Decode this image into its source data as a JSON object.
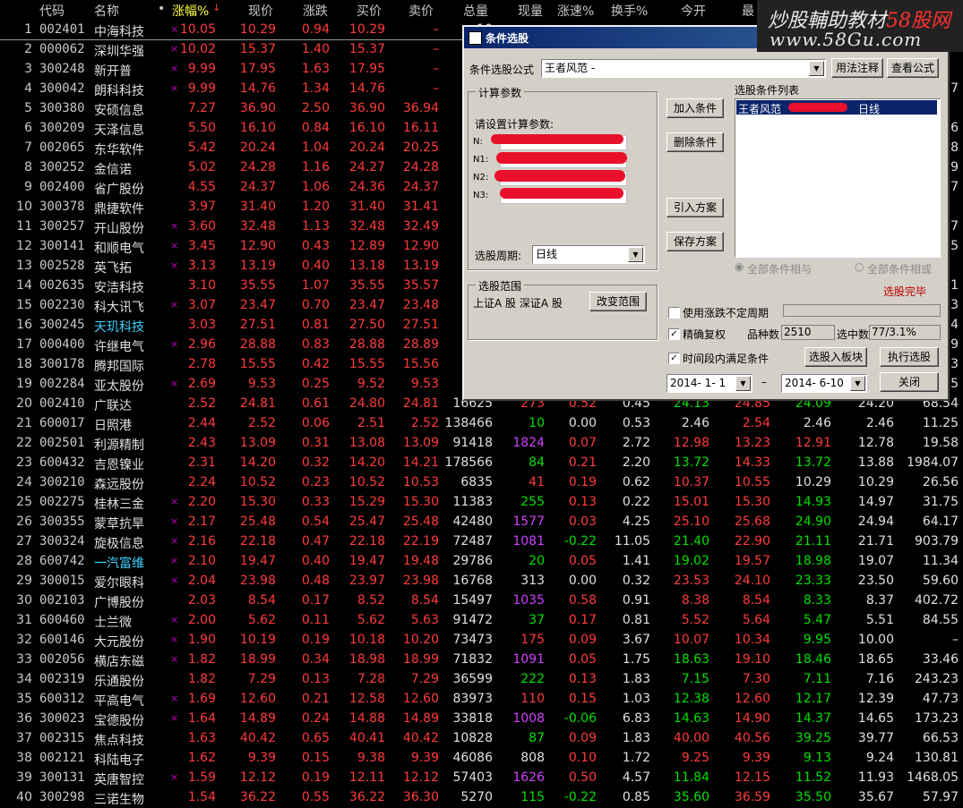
{
  "colors": {
    "up": "#ff3b3b",
    "down": "#00e000",
    "flat": "#e0e0e0",
    "accent": "#ffff40",
    "watermark_red": "#ff3030"
  },
  "header": {
    "code": "代码",
    "name": "名称",
    "dot": "•",
    "pct": "涨幅%",
    "price": "现价",
    "chg": "涨跌",
    "buy": "买价",
    "sell": "卖价",
    "vol": "总量",
    "cur": "现量",
    "spd": "涨速%",
    "to": "换手%",
    "open": "今开",
    "high": "最"
  },
  "watermark": {
    "line1a": "炒股輔助教材",
    "line1b": "58股网",
    "line2": "www.58Gu.com"
  },
  "rows": [
    [
      "1",
      "002401",
      "中海科技",
      "×",
      "10.05",
      "10.29",
      "0.94",
      "10.29",
      "–",
      "10",
      "",
      "",
      "",
      "",
      "",
      "",
      "",
      ""
    ],
    [
      "2",
      "000062",
      "深圳华强",
      "×",
      "10.02",
      "15.37",
      "1.40",
      "15.37",
      "–",
      "24",
      "",
      "",
      "",
      "",
      "",
      "",
      "",
      ""
    ],
    [
      "3",
      "300248",
      "新开普",
      "×",
      "9.99",
      "17.95",
      "1.63",
      "17.95",
      "–",
      "",
      "",
      "",
      "",
      "",
      "",
      "",
      "",
      ""
    ],
    [
      "4",
      "300042",
      "朗科科技",
      "×",
      "9.99",
      "14.76",
      "1.34",
      "14.76",
      "–",
      "6",
      "",
      "",
      "",
      "",
      "",
      "",
      "",
      "57"
    ],
    [
      "5",
      "300380",
      "安硕信息",
      "",
      "7.27",
      "36.90",
      "2.50",
      "36.90",
      "36.94",
      "3",
      "",
      "",
      "",
      "",
      "",
      "",
      "",
      ""
    ],
    [
      "6",
      "300209",
      "天泽信息",
      "",
      "5.50",
      "16.10",
      "0.84",
      "16.10",
      "16.11",
      "2",
      "",
      "",
      "",
      "",
      "",
      "",
      "",
      "46"
    ],
    [
      "7",
      "002065",
      "东华软件",
      "",
      "5.42",
      "20.24",
      "1.04",
      "20.24",
      "20.25",
      "7",
      "",
      "",
      "",
      "",
      "",
      "",
      "",
      "78"
    ],
    [
      "8",
      "300252",
      "金信诺",
      "",
      "5.02",
      "24.28",
      "1.16",
      "24.27",
      "24.28",
      "1",
      "",
      "",
      "",
      "",
      "",
      "",
      "",
      "59"
    ],
    [
      "9",
      "002400",
      "省广股份",
      "",
      "4.55",
      "24.37",
      "1.06",
      "24.36",
      "24.37",
      "4",
      "",
      "",
      "",
      "",
      "",
      "",
      "",
      "87"
    ],
    [
      "10",
      "300378",
      "鼎捷软件",
      "",
      "3.97",
      "31.40",
      "1.20",
      "31.40",
      "31.41",
      "2",
      "",
      "",
      "",
      "",
      "",
      "",
      "",
      ""
    ],
    [
      "11",
      "300257",
      "开山股份",
      "×",
      "3.60",
      "32.48",
      "1.13",
      "32.48",
      "32.49",
      "2",
      "",
      "",
      "",
      "",
      "",
      "",
      "",
      "97"
    ],
    [
      "12",
      "300141",
      "和顺电气",
      "×",
      "3.45",
      "12.90",
      "0.43",
      "12.89",
      "12.90",
      "8",
      "",
      "",
      "",
      "",
      "",
      "",
      "",
      "95"
    ],
    [
      "13",
      "002528",
      "英飞拓",
      "×",
      "3.13",
      "13.19",
      "0.40",
      "13.18",
      "13.19",
      "7",
      "",
      "",
      "",
      "",
      "",
      "",
      "",
      ""
    ],
    [
      "14",
      "002635",
      "安洁科技",
      "",
      "3.10",
      "35.55",
      "1.07",
      "35.55",
      "35.57",
      "1",
      "",
      "",
      "",
      "",
      "",
      "",
      "",
      "71"
    ],
    [
      "15",
      "002230",
      "科大讯飞",
      "×",
      "3.07",
      "23.47",
      "0.70",
      "23.47",
      "23.48",
      "7",
      "",
      "",
      "",
      "",
      "",
      "",
      "",
      "33"
    ],
    [
      "16",
      "300245",
      "天玑科技",
      "",
      "3.03",
      "27.51",
      "0.81",
      "27.50",
      "27.51",
      "2",
      "",
      "",
      "",
      "",
      "",
      "",
      "",
      "54"
    ],
    [
      "17",
      "000400",
      "许继电气",
      "×",
      "2.96",
      "28.88",
      "0.83",
      "28.88",
      "28.89",
      "6",
      "",
      "",
      "",
      "",
      "",
      "",
      "",
      "09"
    ],
    [
      "18",
      "300178",
      "腾邦国际",
      "",
      "2.78",
      "15.55",
      "0.42",
      "15.55",
      "15.56",
      "6",
      "",
      "",
      "",
      "",
      "",
      "",
      "",
      "53"
    ],
    [
      "19",
      "002284",
      "亚太股份",
      "×",
      "2.69",
      "9.53",
      "0.25",
      "9.52",
      "9.53",
      "1",
      "",
      "",
      "",
      "",
      "",
      "",
      "",
      "05"
    ],
    [
      "20",
      "002410",
      "广联达",
      "",
      "2.52",
      "24.81",
      "0.61",
      "24.80",
      "24.81",
      "16625",
      "273",
      "0.52",
      "0.45",
      "24.13",
      "24.85",
      "24.09",
      "24.20",
      "68.54"
    ],
    [
      "21",
      "600017",
      "日照港",
      "",
      "2.44",
      "2.52",
      "0.06",
      "2.51",
      "2.52",
      "138466",
      "10",
      "0.00",
      "0.53",
      "2.46",
      "2.54",
      "2.46",
      "2.46",
      "11.25"
    ],
    [
      "22",
      "002501",
      "利源精制",
      "",
      "2.43",
      "13.09",
      "0.31",
      "13.08",
      "13.09",
      "91418",
      "1824",
      "0.07",
      "2.72",
      "12.98",
      "13.23",
      "12.91",
      "12.78",
      "19.58"
    ],
    [
      "23",
      "600432",
      "吉恩镍业",
      "",
      "2.31",
      "14.20",
      "0.32",
      "14.20",
      "14.21",
      "178566",
      "84",
      "0.21",
      "2.20",
      "13.72",
      "14.33",
      "13.72",
      "13.88",
      "1984.07"
    ],
    [
      "24",
      "300210",
      "森远股份",
      "",
      "2.24",
      "10.52",
      "0.23",
      "10.52",
      "10.53",
      "6835",
      "41",
      "0.19",
      "0.62",
      "10.37",
      "10.55",
      "10.29",
      "10.29",
      "26.56"
    ],
    [
      "25",
      "002275",
      "桂林三金",
      "×",
      "2.20",
      "15.30",
      "0.33",
      "15.29",
      "15.30",
      "11383",
      "255",
      "0.13",
      "0.22",
      "15.01",
      "15.30",
      "14.93",
      "14.97",
      "31.75"
    ],
    [
      "26",
      "300355",
      "蒙草抗旱",
      "×",
      "2.17",
      "25.48",
      "0.54",
      "25.47",
      "25.48",
      "42480",
      "1577",
      "0.03",
      "4.25",
      "25.10",
      "25.68",
      "24.90",
      "24.94",
      "64.17"
    ],
    [
      "27",
      "300324",
      "旋极信息",
      "×",
      "2.16",
      "22.18",
      "0.47",
      "22.18",
      "22.19",
      "72487",
      "1081",
      "-0.22",
      "11.05",
      "21.40",
      "22.90",
      "21.11",
      "21.71",
      "903.79"
    ],
    [
      "28",
      "600742",
      "一汽富维",
      "×",
      "2.10",
      "19.47",
      "0.40",
      "19.47",
      "19.48",
      "29786",
      "20",
      "0.05",
      "1.41",
      "19.02",
      "19.57",
      "18.98",
      "19.07",
      "11.34"
    ],
    [
      "29",
      "300015",
      "爱尔眼科",
      "×",
      "2.04",
      "23.98",
      "0.48",
      "23.97",
      "23.98",
      "16768",
      "313",
      "0.00",
      "0.32",
      "23.53",
      "24.10",
      "23.33",
      "23.50",
      "59.60"
    ],
    [
      "30",
      "002103",
      "广博股份",
      "",
      "2.03",
      "8.54",
      "0.17",
      "8.52",
      "8.54",
      "15497",
      "1035",
      "0.58",
      "0.91",
      "8.38",
      "8.54",
      "8.33",
      "8.37",
      "402.72"
    ],
    [
      "31",
      "600460",
      "士兰微",
      "×",
      "2.00",
      "5.62",
      "0.11",
      "5.62",
      "5.63",
      "91472",
      "37",
      "0.17",
      "0.81",
      "5.52",
      "5.64",
      "5.47",
      "5.51",
      "84.55"
    ],
    [
      "32",
      "600146",
      "大元股份",
      "×",
      "1.90",
      "10.19",
      "0.19",
      "10.18",
      "10.20",
      "73473",
      "175",
      "0.09",
      "3.67",
      "10.07",
      "10.34",
      "9.95",
      "10.00",
      "–"
    ],
    [
      "33",
      "002056",
      "横店东磁",
      "×",
      "1.82",
      "18.99",
      "0.34",
      "18.98",
      "18.99",
      "71832",
      "1091",
      "0.05",
      "1.75",
      "18.63",
      "19.10",
      "18.46",
      "18.65",
      "33.46"
    ],
    [
      "34",
      "002319",
      "乐通股份",
      "",
      "1.82",
      "7.29",
      "0.13",
      "7.28",
      "7.29",
      "36599",
      "222",
      "0.13",
      "1.83",
      "7.15",
      "7.30",
      "7.11",
      "7.16",
      "243.23"
    ],
    [
      "35",
      "600312",
      "平高电气",
      "×",
      "1.69",
      "12.60",
      "0.21",
      "12.58",
      "12.60",
      "83973",
      "110",
      "0.15",
      "1.03",
      "12.38",
      "12.60",
      "12.17",
      "12.39",
      "47.73"
    ],
    [
      "36",
      "300023",
      "宝德股份",
      "×",
      "1.64",
      "14.89",
      "0.24",
      "14.88",
      "14.89",
      "33818",
      "1008",
      "-0.06",
      "6.83",
      "14.63",
      "14.90",
      "14.37",
      "14.65",
      "173.23"
    ],
    [
      "37",
      "002315",
      "焦点科技",
      "",
      "1.63",
      "40.42",
      "0.65",
      "40.41",
      "40.42",
      "10828",
      "87",
      "0.09",
      "1.83",
      "40.00",
      "40.56",
      "39.25",
      "39.77",
      "66.53"
    ],
    [
      "38",
      "002121",
      "科陆电子",
      "",
      "1.62",
      "9.39",
      "0.15",
      "9.38",
      "9.39",
      "46086",
      "808",
      "0.10",
      "1.72",
      "9.25",
      "9.39",
      "9.13",
      "9.24",
      "130.81"
    ],
    [
      "39",
      "300131",
      "英唐智控",
      "×",
      "1.59",
      "12.12",
      "0.19",
      "12.11",
      "12.12",
      "57403",
      "1626",
      "0.50",
      "4.57",
      "11.84",
      "12.15",
      "11.52",
      "11.93",
      "1468.05"
    ],
    [
      "40",
      "300298",
      "三诺生物",
      "",
      "1.54",
      "36.22",
      "0.55",
      "36.22",
      "36.30",
      "5270",
      "115",
      "-0.22",
      "0.85",
      "35.60",
      "36.59",
      "35.50",
      "35.67",
      "57.97"
    ]
  ],
  "name_colors": {
    "16": "cyan",
    "28": "cyan"
  },
  "dialog": {
    "title": "条件选股",
    "close_glyph": "×",
    "formula_label": "条件选股公式",
    "formula_value": "王者风范 -",
    "usage_button": "用法注释",
    "view_button": "查看公式",
    "params_group": "计算参数",
    "params_prompt": "请设置计算参数:",
    "param_labels": [
      "N:",
      "N1:",
      "N2:",
      "N3:"
    ],
    "period_label": "选股周期:",
    "period_value": "日线",
    "scope_group": "选股范围",
    "scope_value": "上证A 股 深证A 股",
    "change_scope_button": "改变范围",
    "add_button": "加入条件",
    "delete_button": "删除条件",
    "import_button": "引入方案",
    "save_button": "保存方案",
    "list_label": "选股条件列表",
    "list_item_name": "王者风范",
    "list_item_period": "日线",
    "radio_and": "全部条件相与",
    "radio_or": "全部条件相或",
    "status": "选股完毕",
    "use_range_label": "使用涨跌不定周期",
    "precise_label": "精确复权",
    "count_label": "品种数",
    "count_value": "2510",
    "selected_label": "选中数",
    "selected_value": "77/3.1%",
    "time_label": "时间段内满足条件",
    "to_block_button": "选股入板块",
    "run_button": "执行选股",
    "date_from": "2014- 1- 1",
    "date_sep": "–",
    "date_to": "2014- 6-10",
    "close_button": "关闭"
  }
}
